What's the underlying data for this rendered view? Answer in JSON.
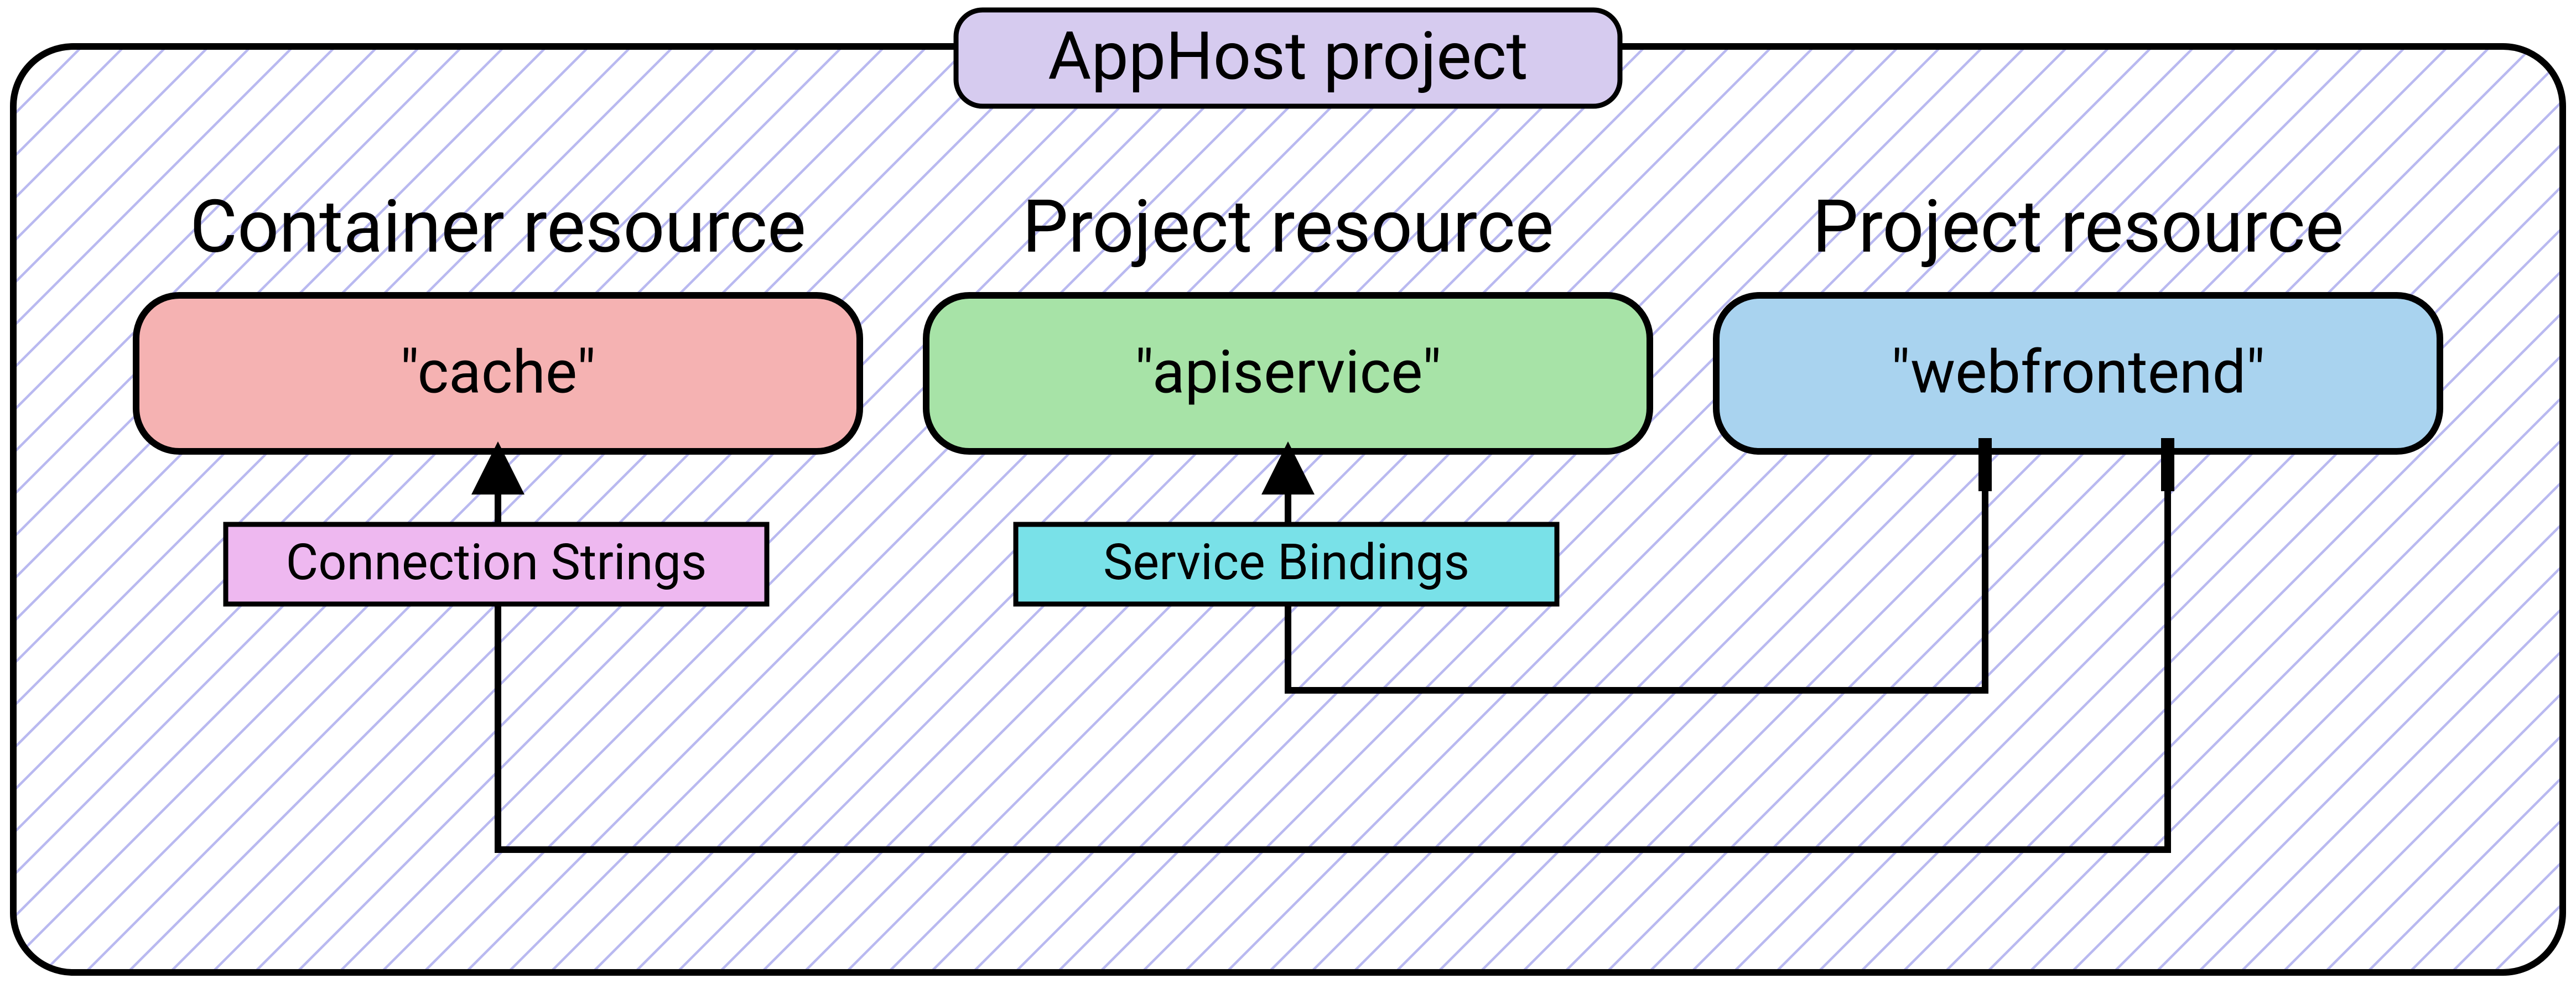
{
  "diagram": {
    "title": "AppHost project",
    "columns": [
      {
        "heading": "Container resource",
        "box": "\"cache\""
      },
      {
        "heading": "Project resource",
        "box": "\"apiservice\""
      },
      {
        "heading": "Project resource",
        "box": "\"webfrontend\""
      }
    ],
    "connectors": {
      "connection_strings": "Connection Strings",
      "service_bindings": "Service Bindings"
    },
    "edges": [
      {
        "from": "webfrontend",
        "via": "Connection Strings",
        "to": "cache"
      },
      {
        "from": "webfrontend",
        "via": "Service Bindings",
        "to": "apiservice"
      }
    ],
    "colors": {
      "title_fill": "#d6cbef",
      "cache_fill": "#f5b2b2",
      "apiservice_fill": "#a7e3a7",
      "webfrontend_fill": "#a9d3ef",
      "conn_strings_fill": "#eeb8f0",
      "svc_bindings_fill": "#79e1e8",
      "hatch": "#b9b9f0",
      "stroke": "#000000"
    }
  }
}
